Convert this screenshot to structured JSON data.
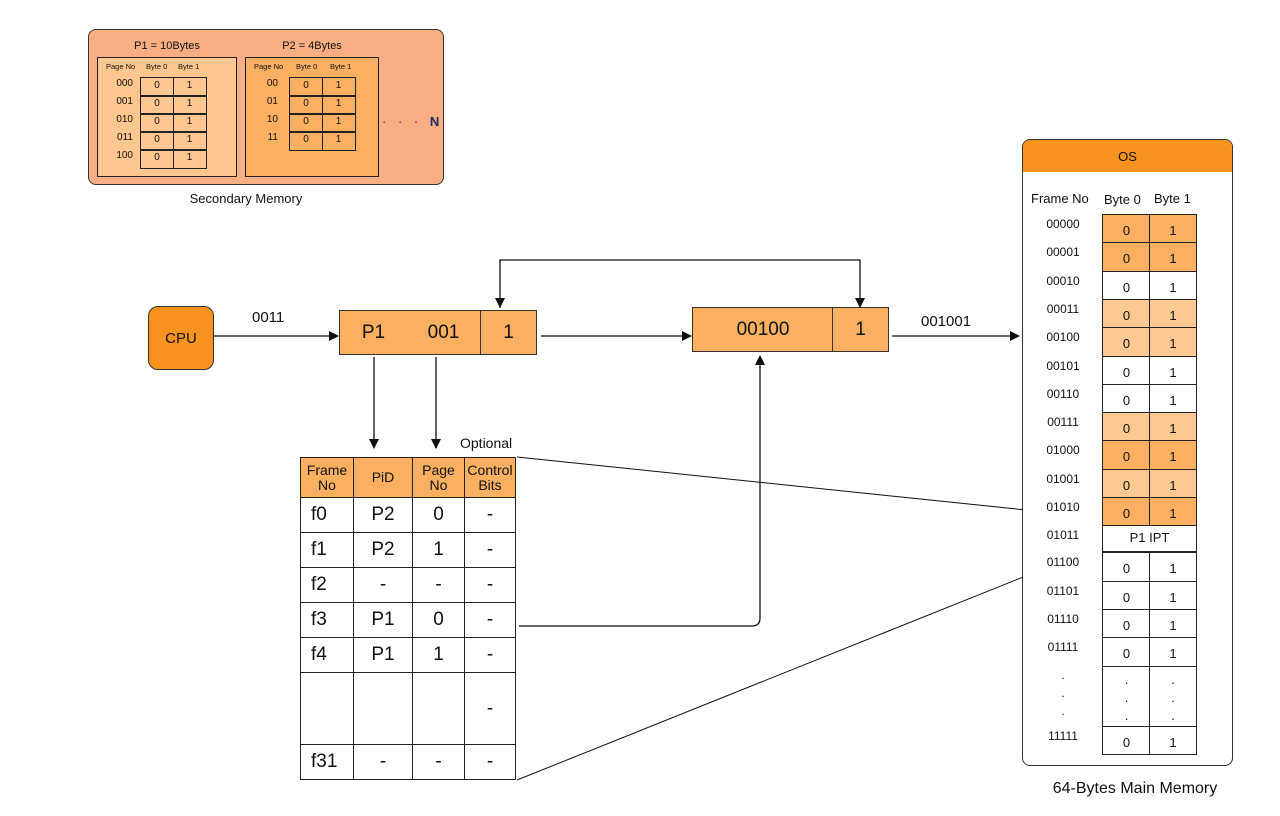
{
  "secondary_memory": {
    "caption": "Secondary Memory",
    "more_indicator": "· · ·",
    "more_label": "N",
    "processes": [
      {
        "title": "P1 = 10Bytes",
        "headers": [
          "Page No",
          "Byte 0",
          "Byte 1"
        ],
        "rows": [
          {
            "page": "000",
            "b0": "0",
            "b1": "1"
          },
          {
            "page": "001",
            "b0": "0",
            "b1": "1"
          },
          {
            "page": "010",
            "b0": "0",
            "b1": "1"
          },
          {
            "page": "011",
            "b0": "0",
            "b1": "1"
          },
          {
            "page": "100",
            "b0": "0",
            "b1": "1"
          }
        ]
      },
      {
        "title": "P2 = 4Bytes",
        "headers": [
          "Page No",
          "Byte 0",
          "Byte 1"
        ],
        "rows": [
          {
            "page": "00",
            "b0": "0",
            "b1": "1"
          },
          {
            "page": "01",
            "b0": "0",
            "b1": "1"
          },
          {
            "page": "10",
            "b0": "0",
            "b1": "1"
          },
          {
            "page": "11",
            "b0": "0",
            "b1": "1"
          }
        ]
      }
    ]
  },
  "cpu": {
    "label": "CPU"
  },
  "cpu_output_label": "0011",
  "logical_address": {
    "pid": "P1",
    "page": "001",
    "offset": "1"
  },
  "physical_address": {
    "frame": "00100",
    "offset": "1"
  },
  "physical_output_label": "001001",
  "ipt": {
    "optional_label": "Optional",
    "headers": [
      "Frame No",
      "PiD",
      "Page No",
      "Control Bits"
    ],
    "rows": [
      {
        "frame": "f0",
        "pid": "P2",
        "page": "0",
        "ctrl": "-"
      },
      {
        "frame": "f1",
        "pid": "P2",
        "page": "1",
        "ctrl": "-"
      },
      {
        "frame": "f2",
        "pid": "-",
        "page": "-",
        "ctrl": "-"
      },
      {
        "frame": "f3",
        "pid": "P1",
        "page": "0",
        "ctrl": "-"
      },
      {
        "frame": "f4",
        "pid": "P1",
        "page": "1",
        "ctrl": "-"
      },
      {
        "frame": "",
        "pid": "",
        "page": "",
        "ctrl": "-"
      },
      {
        "frame": "f31",
        "pid": "-",
        "page": "-",
        "ctrl": "-"
      }
    ]
  },
  "main_memory": {
    "os_label": "OS",
    "caption": "64-Bytes Main Memory",
    "headers": [
      "Frame No",
      "Byte 0",
      "Byte 1"
    ],
    "colors": {
      "dark": "#fbb061",
      "light": "#fec991",
      "empty": "#ffffff"
    },
    "rows": [
      {
        "frame": "00000",
        "b0": "0",
        "b1": "1",
        "fill": "dark"
      },
      {
        "frame": "00001",
        "b0": "0",
        "b1": "1",
        "fill": "dark"
      },
      {
        "frame": "00010",
        "b0": "0",
        "b1": "1",
        "fill": "empty"
      },
      {
        "frame": "00011",
        "b0": "0",
        "b1": "1",
        "fill": "light"
      },
      {
        "frame": "00100",
        "b0": "0",
        "b1": "1",
        "fill": "light"
      },
      {
        "frame": "00101",
        "b0": "0",
        "b1": "1",
        "fill": "empty"
      },
      {
        "frame": "00110",
        "b0": "0",
        "b1": "1",
        "fill": "empty"
      },
      {
        "frame": "00111",
        "b0": "0",
        "b1": "1",
        "fill": "light"
      },
      {
        "frame": "01000",
        "b0": "0",
        "b1": "1",
        "fill": "dark"
      },
      {
        "frame": "01001",
        "b0": "0",
        "b1": "1",
        "fill": "light"
      },
      {
        "frame": "01010",
        "b0": "0",
        "b1": "1",
        "fill": "dark"
      },
      {
        "frame": "01011",
        "merged": "P1 IPT",
        "fill": "empty"
      },
      {
        "frame": "01100",
        "b0": "0",
        "b1": "1",
        "fill": "empty"
      },
      {
        "frame": "01101",
        "b0": "0",
        "b1": "1",
        "fill": "empty"
      },
      {
        "frame": "01110",
        "b0": "0",
        "b1": "1",
        "fill": "empty"
      },
      {
        "frame": "01111",
        "b0": "0",
        "b1": "1",
        "fill": "empty"
      },
      {
        "frame": ".\n.\n.",
        "b0": ".\n.\n.",
        "b1": ".\n.\n.",
        "fill": "empty",
        "ellipsis": true
      },
      {
        "frame": "11111",
        "b0": "0",
        "b1": "1",
        "fill": "empty"
      }
    ]
  }
}
